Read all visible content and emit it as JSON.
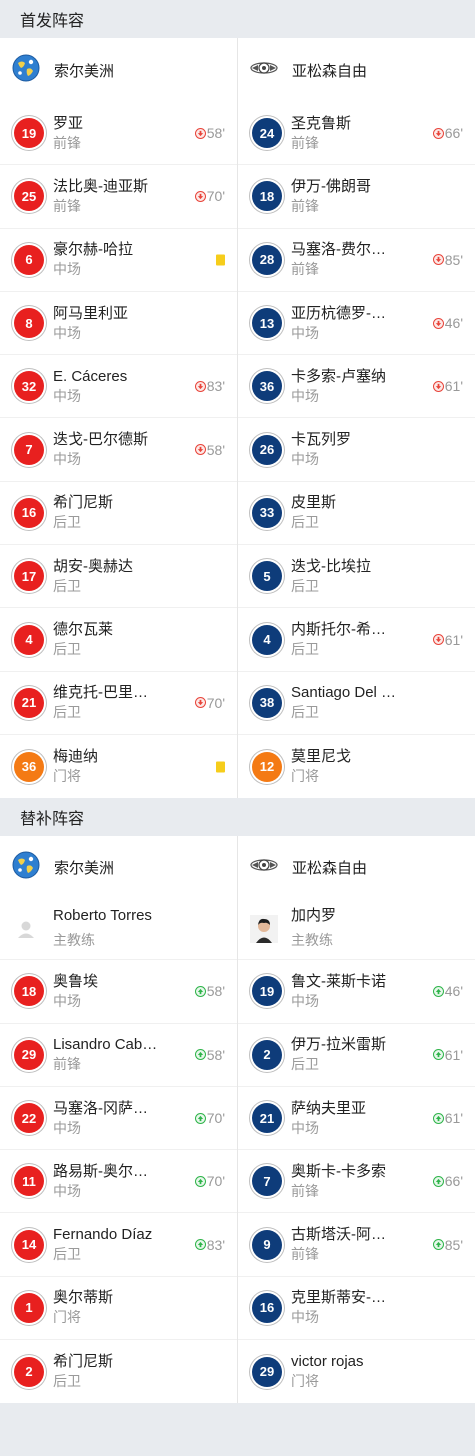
{
  "starters": {
    "header": "首发阵容",
    "home": {
      "team": "索尔美洲",
      "players": [
        {
          "num": "19",
          "name": "罗亚",
          "pos": "前锋",
          "color": "#e8201f",
          "event": "sub-out",
          "minute": "58'"
        },
        {
          "num": "25",
          "name": "法比奥-迪亚斯",
          "pos": "前锋",
          "color": "#e8201f",
          "event": "sub-out",
          "minute": "70'"
        },
        {
          "num": "6",
          "name": "豪尔赫-哈拉",
          "pos": "中场",
          "color": "#e8201f",
          "event": "yellow",
          "minute": ""
        },
        {
          "num": "8",
          "name": "阿马里利亚",
          "pos": "中场",
          "color": "#e8201f",
          "event": "",
          "minute": ""
        },
        {
          "num": "32",
          "name": "E. Cáceres",
          "pos": "中场",
          "color": "#e8201f",
          "event": "sub-out",
          "minute": "83'"
        },
        {
          "num": "7",
          "name": "迭戈-巴尔德斯",
          "pos": "中场",
          "color": "#e8201f",
          "event": "sub-out",
          "minute": "58'"
        },
        {
          "num": "16",
          "name": "希门尼斯",
          "pos": "后卫",
          "color": "#e8201f",
          "event": "",
          "minute": ""
        },
        {
          "num": "17",
          "name": "胡安-奥赫达",
          "pos": "后卫",
          "color": "#e8201f",
          "event": "",
          "minute": ""
        },
        {
          "num": "4",
          "name": "德尔瓦莱",
          "pos": "后卫",
          "color": "#e8201f",
          "event": "",
          "minute": ""
        },
        {
          "num": "21",
          "name": "维克托-巴里…",
          "pos": "后卫",
          "color": "#e8201f",
          "event": "sub-out",
          "minute": "70'"
        },
        {
          "num": "36",
          "name": "梅迪纳",
          "pos": "门将",
          "color": "#f47a14",
          "event": "yellow",
          "minute": ""
        }
      ]
    },
    "away": {
      "team": "亚松森自由",
      "players": [
        {
          "num": "24",
          "name": "圣克鲁斯",
          "pos": "前锋",
          "color": "#0e3c7a",
          "event": "sub-out",
          "minute": "66'"
        },
        {
          "num": "18",
          "name": "伊万-佛朗哥",
          "pos": "前锋",
          "color": "#0e3c7a",
          "event": "",
          "minute": ""
        },
        {
          "num": "28",
          "name": "马塞洛-费尔…",
          "pos": "前锋",
          "color": "#0e3c7a",
          "event": "sub-out",
          "minute": "85'"
        },
        {
          "num": "13",
          "name": "亚历杭德罗-…",
          "pos": "中场",
          "color": "#0e3c7a",
          "event": "sub-out",
          "minute": "46'"
        },
        {
          "num": "36",
          "name": "卡多索-卢塞纳",
          "pos": "中场",
          "color": "#0e3c7a",
          "event": "sub-out",
          "minute": "61'"
        },
        {
          "num": "26",
          "name": "卡瓦列罗",
          "pos": "中场",
          "color": "#0e3c7a",
          "event": "",
          "minute": ""
        },
        {
          "num": "33",
          "name": "皮里斯",
          "pos": "后卫",
          "color": "#0e3c7a",
          "event": "",
          "minute": ""
        },
        {
          "num": "5",
          "name": "迭戈-比埃拉",
          "pos": "后卫",
          "color": "#0e3c7a",
          "event": "",
          "minute": ""
        },
        {
          "num": "4",
          "name": "内斯托尔-希…",
          "pos": "后卫",
          "color": "#0e3c7a",
          "event": "sub-out",
          "minute": "61'"
        },
        {
          "num": "38",
          "name": "Santiago Del …",
          "pos": "后卫",
          "color": "#0e3c7a",
          "event": "",
          "minute": ""
        },
        {
          "num": "12",
          "name": "莫里尼戈",
          "pos": "门将",
          "color": "#f47a14",
          "event": "",
          "minute": ""
        }
      ]
    }
  },
  "subs": {
    "header": "替补阵容",
    "home": {
      "team": "索尔美洲",
      "coach": {
        "name": "Roberto Torres",
        "role": "主教练"
      },
      "players": [
        {
          "num": "18",
          "name": "奥鲁埃",
          "pos": "中场",
          "color": "#e8201f",
          "event": "sub-in",
          "minute": "58'"
        },
        {
          "num": "29",
          "name": "Lisandro Cab…",
          "pos": "前锋",
          "color": "#e8201f",
          "event": "sub-in",
          "minute": "58'"
        },
        {
          "num": "22",
          "name": "马塞洛-冈萨…",
          "pos": "中场",
          "color": "#e8201f",
          "event": "sub-in",
          "minute": "70'"
        },
        {
          "num": "11",
          "name": "路易斯-奥尔…",
          "pos": "中场",
          "color": "#e8201f",
          "event": "sub-in",
          "minute": "70'"
        },
        {
          "num": "14",
          "name": "Fernando Díaz",
          "pos": "后卫",
          "color": "#e8201f",
          "event": "sub-in",
          "minute": "83'"
        },
        {
          "num": "1",
          "name": "奥尔蒂斯",
          "pos": "门将",
          "color": "#e8201f",
          "event": "",
          "minute": ""
        },
        {
          "num": "2",
          "name": "希门尼斯",
          "pos": "后卫",
          "color": "#e8201f",
          "event": "",
          "minute": ""
        }
      ]
    },
    "away": {
      "team": "亚松森自由",
      "coach": {
        "name": "加内罗",
        "role": "主教练"
      },
      "players": [
        {
          "num": "19",
          "name": "鲁文-莱斯卡诺",
          "pos": "中场",
          "color": "#0e3c7a",
          "event": "sub-in",
          "minute": "46'"
        },
        {
          "num": "2",
          "name": "伊万-拉米雷斯",
          "pos": "后卫",
          "color": "#0e3c7a",
          "event": "sub-in",
          "minute": "61'"
        },
        {
          "num": "21",
          "name": "萨纳夫里亚",
          "pos": "中场",
          "color": "#0e3c7a",
          "event": "sub-in",
          "minute": "61'"
        },
        {
          "num": "7",
          "name": "奥斯卡-卡多索",
          "pos": "前锋",
          "color": "#0e3c7a",
          "event": "sub-in",
          "minute": "66'"
        },
        {
          "num": "9",
          "name": "古斯塔沃-阿…",
          "pos": "前锋",
          "color": "#0e3c7a",
          "event": "sub-in",
          "minute": "85'"
        },
        {
          "num": "16",
          "name": "克里斯蒂安-…",
          "pos": "中场",
          "color": "#0e3c7a",
          "event": "",
          "minute": ""
        },
        {
          "num": "29",
          "name": "victor rojas",
          "pos": "门将",
          "color": "#0e3c7a",
          "event": "",
          "minute": ""
        }
      ]
    }
  }
}
